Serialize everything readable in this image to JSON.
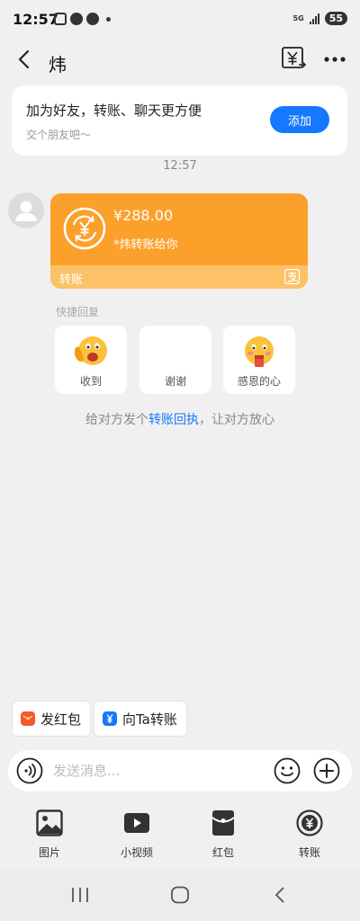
{
  "status_bar": {
    "time": "12:57",
    "network": "5G",
    "battery": "55",
    "icons": [
      "scan-icon",
      "message-icon",
      "wechat-icon",
      "dot"
    ]
  },
  "header": {
    "title": "炜",
    "back_icon": "back-arrow-icon",
    "transfer_icon": "yuan-transfer-icon",
    "more_icon": "more-dots-icon"
  },
  "friend_card": {
    "title": "加为好友，转账、聊天更方便",
    "subtitle": "交个朋友吧～",
    "add_label": "添加"
  },
  "timestamp": "12:57",
  "transfer_message": {
    "amount": "¥288.00",
    "note": "*炜转账给你",
    "label": "转账",
    "colors": {
      "main": "#fca02c",
      "footer": "#fdc267"
    }
  },
  "quick_reply": {
    "label": "快捷回复",
    "items": [
      {
        "text": "收到",
        "icon": "waving-emoji-icon"
      },
      {
        "text": "谢谢",
        "icon": ""
      },
      {
        "text": "感恩的心",
        "icon": "grateful-emoji-icon"
      }
    ]
  },
  "hint": {
    "prefix": "给对方发个",
    "link": "转账回执",
    "suffix": "，让对方放心"
  },
  "chips": [
    {
      "label": "发红包",
      "icon": "red-packet-icon",
      "color": "#f25a2a"
    },
    {
      "label": "向Ta转账",
      "icon": "yuan-icon",
      "color": "#1677ff"
    }
  ],
  "input": {
    "placeholder": "发送消息..."
  },
  "tools": [
    {
      "label": "图片",
      "icon": "image-icon"
    },
    {
      "label": "小视频",
      "icon": "video-icon"
    },
    {
      "label": "红包",
      "icon": "red-packet-icon"
    },
    {
      "label": "转账",
      "icon": "transfer-icon"
    }
  ],
  "nav": [
    "recent-apps-icon",
    "home-icon",
    "back-icon"
  ]
}
